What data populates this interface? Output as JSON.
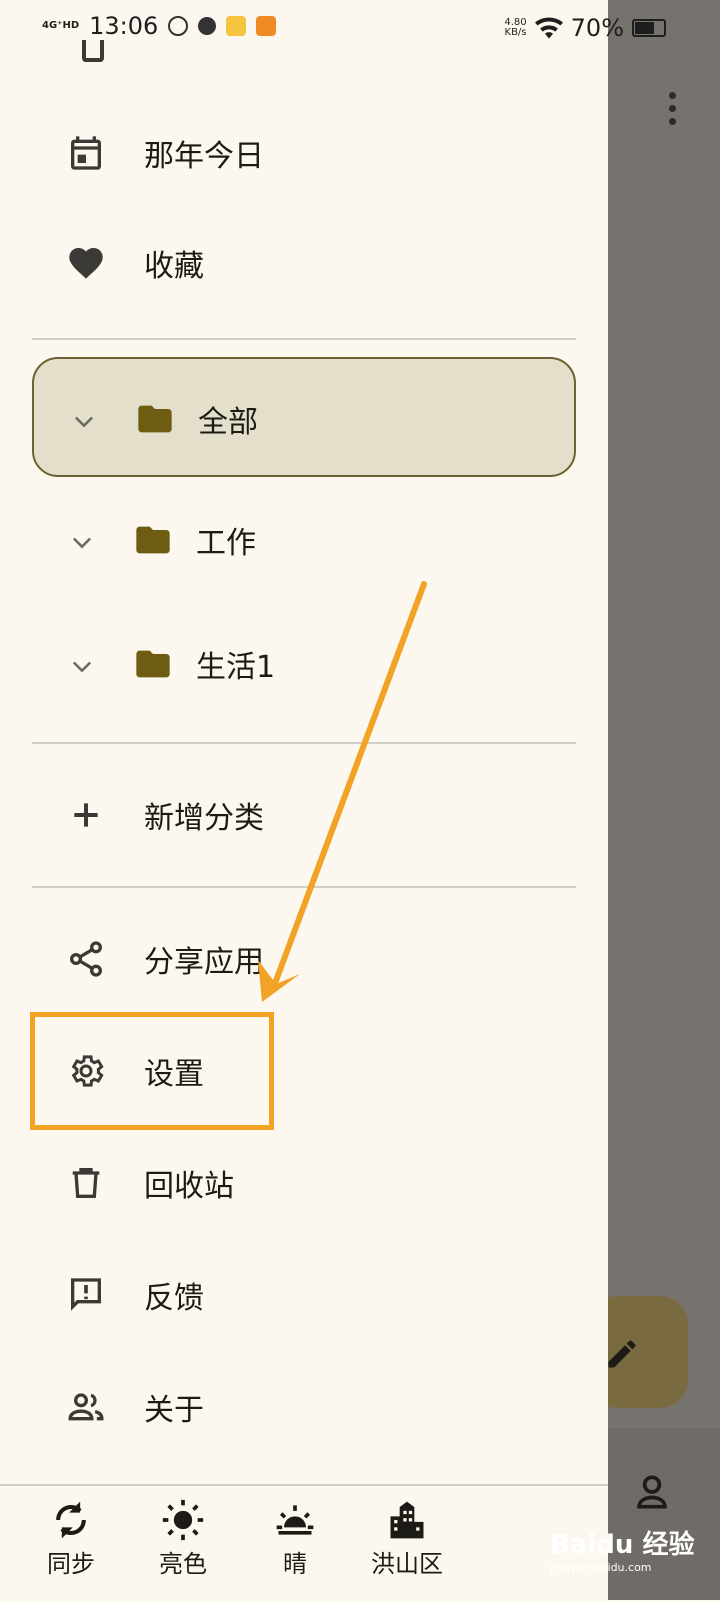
{
  "status_bar": {
    "network": "4G⁺HD",
    "time": "13:06",
    "speed_value": "4.80",
    "speed_unit": "KB/s",
    "battery": "70%"
  },
  "drawer": {
    "items_top": [
      {
        "id": "history",
        "label": "那年今日",
        "icon": "calendar-icon"
      },
      {
        "id": "favorites",
        "label": "收藏",
        "icon": "heart-icon"
      }
    ],
    "folders": [
      {
        "label": "全部",
        "selected": true
      },
      {
        "label": "工作",
        "selected": false
      },
      {
        "label": "生活1",
        "selected": false
      }
    ],
    "add_category": "新增分类",
    "items_bottom": [
      {
        "id": "share",
        "label": "分享应用",
        "icon": "share-icon"
      },
      {
        "id": "settings",
        "label": "设置",
        "icon": "gear-icon"
      },
      {
        "id": "trash",
        "label": "回收站",
        "icon": "trash-icon"
      },
      {
        "id": "feedback",
        "label": "反馈",
        "icon": "feedback-icon"
      },
      {
        "id": "about",
        "label": "关于",
        "icon": "people-icon"
      }
    ]
  },
  "bottom_bar": {
    "tabs": [
      {
        "label": "同步",
        "icon": "sync-icon"
      },
      {
        "label": "亮色",
        "icon": "sun-icon"
      },
      {
        "label": "晴",
        "icon": "sunrise-icon"
      },
      {
        "label": "洪山区",
        "icon": "city-icon"
      }
    ]
  },
  "watermark": {
    "text": "Baidu 经验",
    "sub": "jingyan.baidu.com"
  },
  "colors": {
    "drawer_bg": "#fdf8ef",
    "selected_bg": "#e4dfca",
    "folder": "#6e5c12",
    "highlight": "#f2a225",
    "backdrop": "#76726d"
  }
}
